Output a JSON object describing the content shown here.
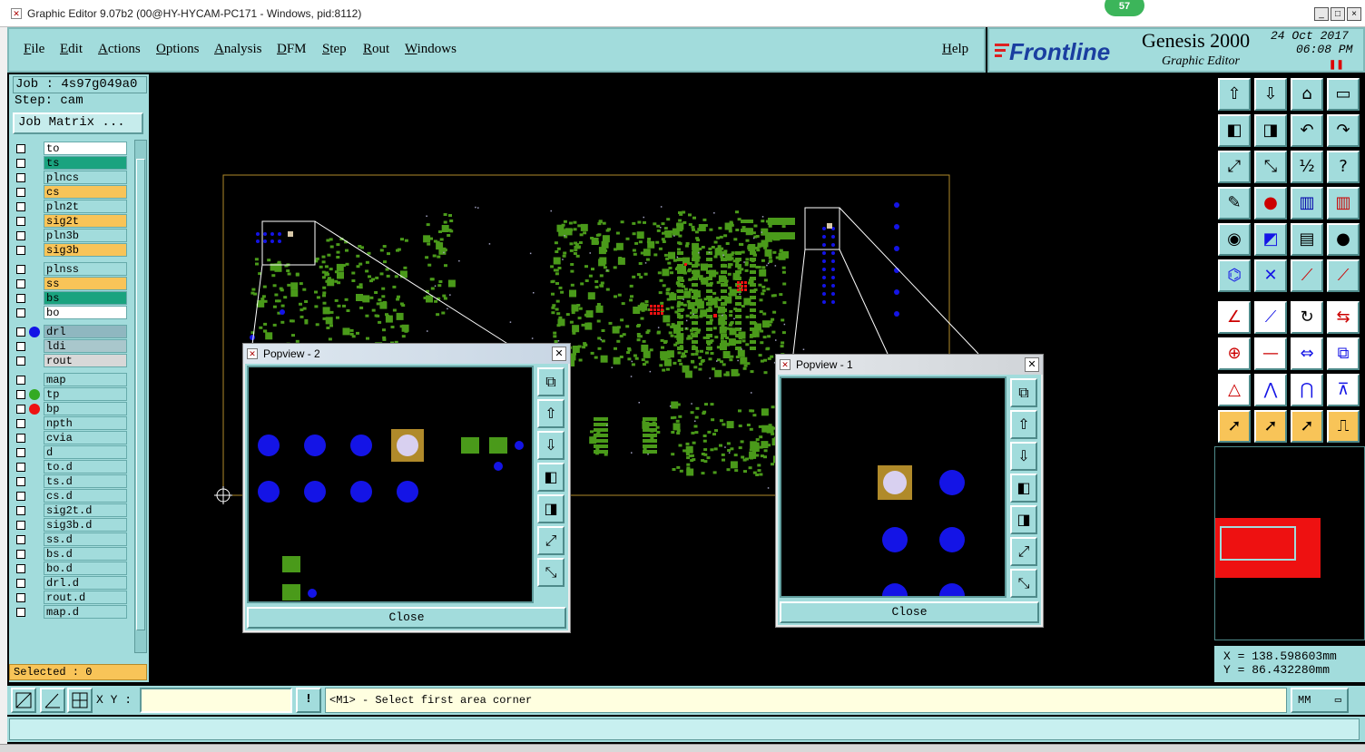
{
  "window": {
    "title": "Graphic Editor 9.07b2 (00@HY-HYCAM-PC171 - Windows, pid:8112)",
    "notification_count": "57",
    "minimize_glyph": "_",
    "maximize_glyph": "□",
    "close_glyph": "×"
  },
  "menu": {
    "items": [
      {
        "first": "F",
        "rest": "ile"
      },
      {
        "first": "E",
        "rest": "dit"
      },
      {
        "first": "A",
        "rest": "ctions"
      },
      {
        "first": "O",
        "rest": "ptions"
      },
      {
        "first": "A",
        "rest": "nalysis"
      },
      {
        "first": "D",
        "rest": "FM"
      },
      {
        "first": "S",
        "rest": "tep"
      },
      {
        "first": "R",
        "rest": "out"
      },
      {
        "first": "W",
        "rest": "indows"
      }
    ],
    "help": {
      "first": "H",
      "rest": "elp"
    }
  },
  "brand": {
    "logo_text": "Frontline",
    "product": "Genesis 2000",
    "subtitle": "Graphic Editor",
    "date": "24 Oct 2017",
    "time": "06:08 PM"
  },
  "job": {
    "job_line": "Job : 4s97g049a0",
    "step_line": "Step: cam",
    "matrix_button": "Job Matrix ..."
  },
  "layers": [
    {
      "name": "to",
      "bg": "#ffffff",
      "dot": ""
    },
    {
      "name": "ts",
      "bg": "#1aa37f",
      "dot": ""
    },
    {
      "name": "plncs",
      "bg": "#a2dcdc",
      "dot": ""
    },
    {
      "name": "cs",
      "bg": "#f8c458",
      "dot": ""
    },
    {
      "name": "pln2t",
      "bg": "#a2dcdc",
      "dot": ""
    },
    {
      "name": "sig2t",
      "bg": "#f8c458",
      "dot": ""
    },
    {
      "name": "pln3b",
      "bg": "#a2dcdc",
      "dot": ""
    },
    {
      "name": "sig3b",
      "bg": "#f8c458",
      "dot": ""
    },
    {
      "name": "plnss",
      "bg": "#a2dcdc",
      "dot": ""
    },
    {
      "name": "ss",
      "bg": "#f8c458",
      "dot": ""
    },
    {
      "name": "bs",
      "bg": "#1aa37f",
      "dot": ""
    },
    {
      "name": "bo",
      "bg": "#ffffff",
      "dot": ""
    },
    {
      "name": "drl",
      "bg": "#8fb7c0",
      "dot": "#1414e6"
    },
    {
      "name": "ldi",
      "bg": "#a9c7cc",
      "dot": ""
    },
    {
      "name": "rout",
      "bg": "#d8d8d8",
      "dot": ""
    },
    {
      "name": "map",
      "bg": "#a2dcdc",
      "dot": ""
    },
    {
      "name": "tp",
      "bg": "#a2dcdc",
      "dot": "#33aa22"
    },
    {
      "name": "bp",
      "bg": "#a2dcdc",
      "dot": "#ee1111"
    },
    {
      "name": "npth",
      "bg": "#a2dcdc",
      "dot": ""
    },
    {
      "name": "cvia",
      "bg": "#a2dcdc",
      "dot": ""
    },
    {
      "name": "d",
      "bg": "#a2dcdc",
      "dot": ""
    },
    {
      "name": "to.d",
      "bg": "#a2dcdc",
      "dot": ""
    },
    {
      "name": "ts.d",
      "bg": "#a2dcdc",
      "dot": ""
    },
    {
      "name": "cs.d",
      "bg": "#a2dcdc",
      "dot": ""
    },
    {
      "name": "sig2t.d",
      "bg": "#a2dcdc",
      "dot": ""
    },
    {
      "name": "sig3b.d",
      "bg": "#a2dcdc",
      "dot": ""
    },
    {
      "name": "ss.d",
      "bg": "#a2dcdc",
      "dot": ""
    },
    {
      "name": "bs.d",
      "bg": "#a2dcdc",
      "dot": ""
    },
    {
      "name": "bo.d",
      "bg": "#a2dcdc",
      "dot": ""
    },
    {
      "name": "drl.d",
      "bg": "#a2dcdc",
      "dot": ""
    },
    {
      "name": "rout.d",
      "bg": "#a2dcdc",
      "dot": ""
    },
    {
      "name": "map.d",
      "bg": "#a2dcdc",
      "dot": ""
    }
  ],
  "selected": "Selected : 0",
  "coords": {
    "x_line": "X = 138.598603mm",
    "y_line": "Y = 86.432280mm"
  },
  "bottom": {
    "xy_label": "X Y :",
    "xy_value": "",
    "bang": "!",
    "prompt": "<M1> - Select first area corner",
    "unit": "MM"
  },
  "popview2": {
    "title": "Popview - 2",
    "close_label": "Close"
  },
  "popview1": {
    "title": "Popview - 1",
    "close_label": "Close"
  },
  "colors": {
    "panel": "#a2dcdc",
    "pad_green": "#4a9a1a",
    "drill_blue": "#1414e6",
    "highlight_red": "#ee1111",
    "profile_tan": "#b08a2a"
  },
  "toolbar_icons": [
    "zoom-home-icon",
    "zoom-in-box-icon",
    "home-icon",
    "window-icon",
    "pan-left-icon",
    "pan-right-icon",
    "undo-view-icon",
    "redraw-icon",
    "fit-all-icon",
    "fit-profile-icon",
    "scale-1-2-icon",
    "help-query-icon",
    "measure-probe-icon",
    "snap-pad-icon",
    "layer-step-icon",
    "layer-step-red-icon",
    "select-feature-icon",
    "draw-line-icon",
    "ruler-icon",
    "round-pad-icon",
    "connect-nodes-icon",
    "delete-x-icon",
    "add-line-icon",
    "add-segment-icon",
    "angle-tool-icon",
    "slash-line-icon",
    "rotate-icon",
    "mirror-icon",
    "move-pad-icon",
    "split-line-icon",
    "stretch-icon",
    "transform-icon",
    "fill-triangle-icon",
    "arc-triangle-icon",
    "arc-up-icon",
    "arc-split-icon",
    "pointer-select-icon",
    "pointer-box-icon",
    "pointer-circle-icon",
    "pointer-step-icon"
  ]
}
